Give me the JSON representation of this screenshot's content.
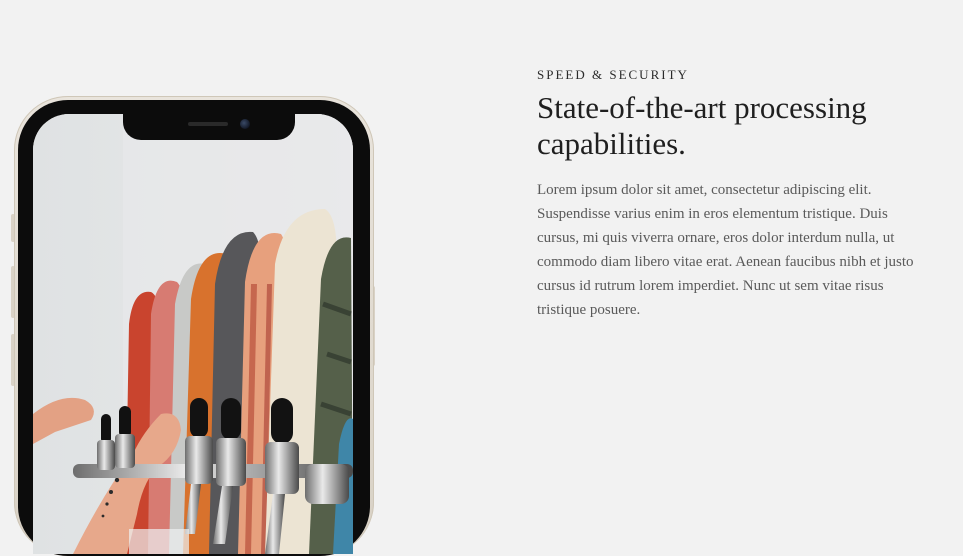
{
  "feature": {
    "eyebrow": "SPEED & SECURITY",
    "headline": "State-of-the-art processing capabilities.",
    "body": "Lorem ipsum dolor sit amet, consectetur adipiscing elit. Suspendisse varius enim in eros elementum tristique. Duis cursus, mi quis viverra ornare, eros dolor interdum nulla, ut commodo diam libero vitae erat. Aenean faucibus nibh et justo cursus id rutrum lorem imperdiet. Nunc ut sem vitae risus tristique posuere."
  },
  "phone_photo": {
    "subject": "beer taps with skateboard-deck handles"
  },
  "colors": {
    "background": "#f2f2f2",
    "heading": "#1f1f1f",
    "body": "#5a5a5a",
    "phone_frame": "#e2dcd2"
  }
}
